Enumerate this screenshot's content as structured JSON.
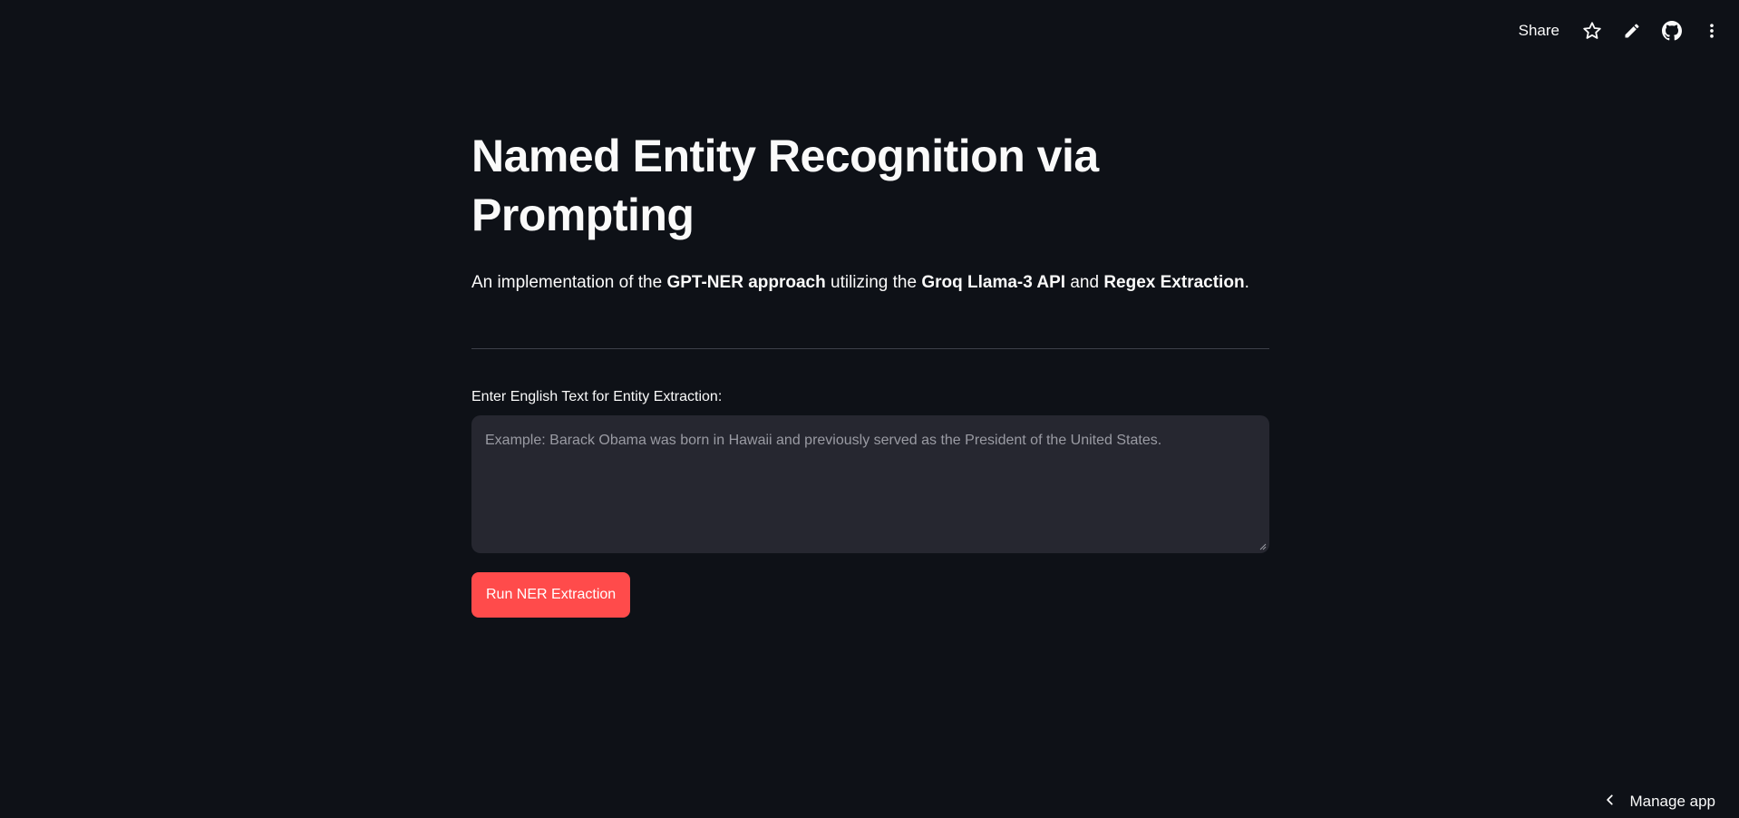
{
  "toolbar": {
    "share_label": "Share",
    "icons": [
      "star-icon",
      "pencil-icon",
      "github-icon",
      "more-vertical-icon"
    ]
  },
  "main": {
    "title": "Named Entity Recognition via Prompting",
    "subtitle": {
      "part1": "An implementation of the ",
      "bold1": "GPT-NER approach",
      "part2": " utilizing the ",
      "bold2": "Groq Llama-3 API",
      "part3": " and ",
      "bold3": "Regex Extraction",
      "part4": "."
    },
    "input_label": "Enter English Text for Entity Extraction:",
    "input_value": "",
    "input_placeholder": "Example: Barack Obama was born in Hawaii and previously served as the President of the United States.",
    "run_button_label": "Run NER Extraction"
  },
  "footer": {
    "manage_label": "Manage app"
  },
  "colors": {
    "background": "#0e1117",
    "input_background": "#262730",
    "accent": "#ff4b4b",
    "text": "#fafafa",
    "placeholder": "#9a9ba3"
  }
}
